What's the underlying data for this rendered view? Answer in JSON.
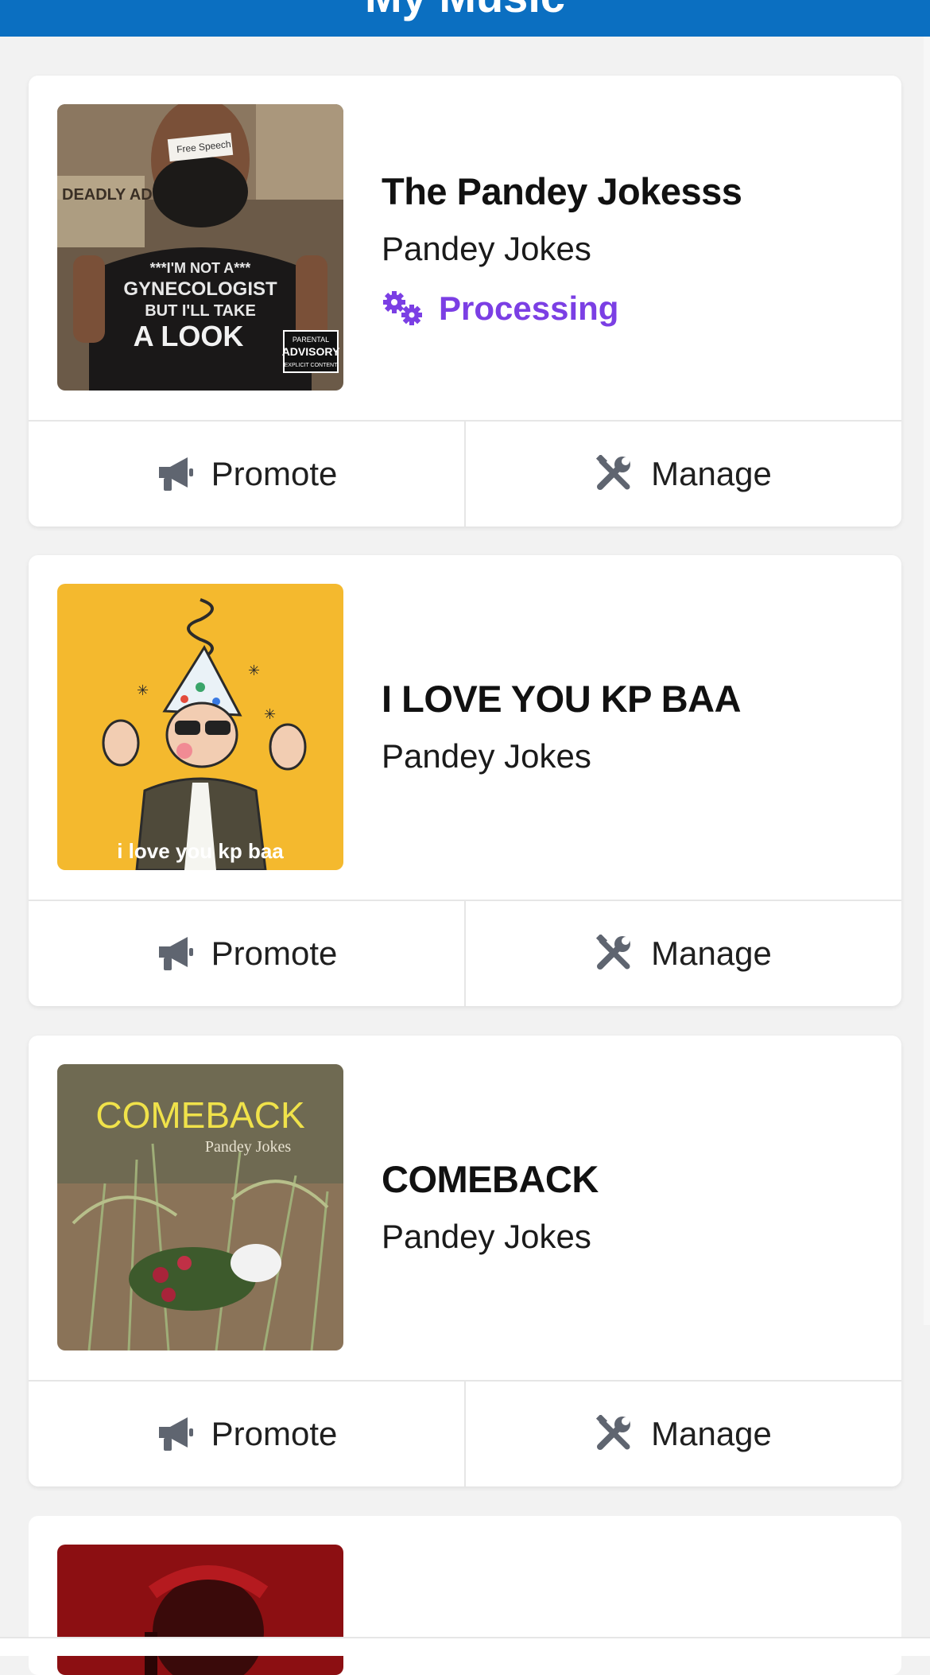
{
  "header": {
    "title": "My Music"
  },
  "releases": [
    {
      "title": "The Pandey Jokesss",
      "artist": "Pandey Jokes",
      "status": "Processing",
      "art": {
        "shirt_lines": [
          "***I'M NOT A***",
          "GYNECOLOGIST",
          "BUT I'LL TAKE",
          "A LOOK"
        ],
        "tape_text": "Free Speech",
        "newspaper_text": "DEADLY ADVICE",
        "advisory_top": "PARENTAL",
        "advisory_mid": "ADVISORY",
        "advisory_bottom": "EXPLICIT CONTENT"
      },
      "promote_label": "Promote",
      "manage_label": "Manage"
    },
    {
      "title": "I LOVE YOU KP BAA",
      "artist": "Pandey Jokes",
      "art": {
        "caption": "i love you kp baa"
      },
      "promote_label": "Promote",
      "manage_label": "Manage"
    },
    {
      "title": "COMEBACK",
      "artist": "Pandey Jokes",
      "art": {
        "title_text": "COMEBACK",
        "subtitle_text": "Pandey Jokes"
      },
      "promote_label": "Promote",
      "manage_label": "Manage"
    }
  ],
  "colors": {
    "header_bg": "#0b6fc1",
    "status_processing": "#7b3fe4",
    "icon_gray": "#5f6570",
    "page_bg": "#f2f2f2"
  },
  "icons": {
    "promote": "megaphone-icon",
    "manage": "tools-icon",
    "processing": "gears-icon"
  }
}
